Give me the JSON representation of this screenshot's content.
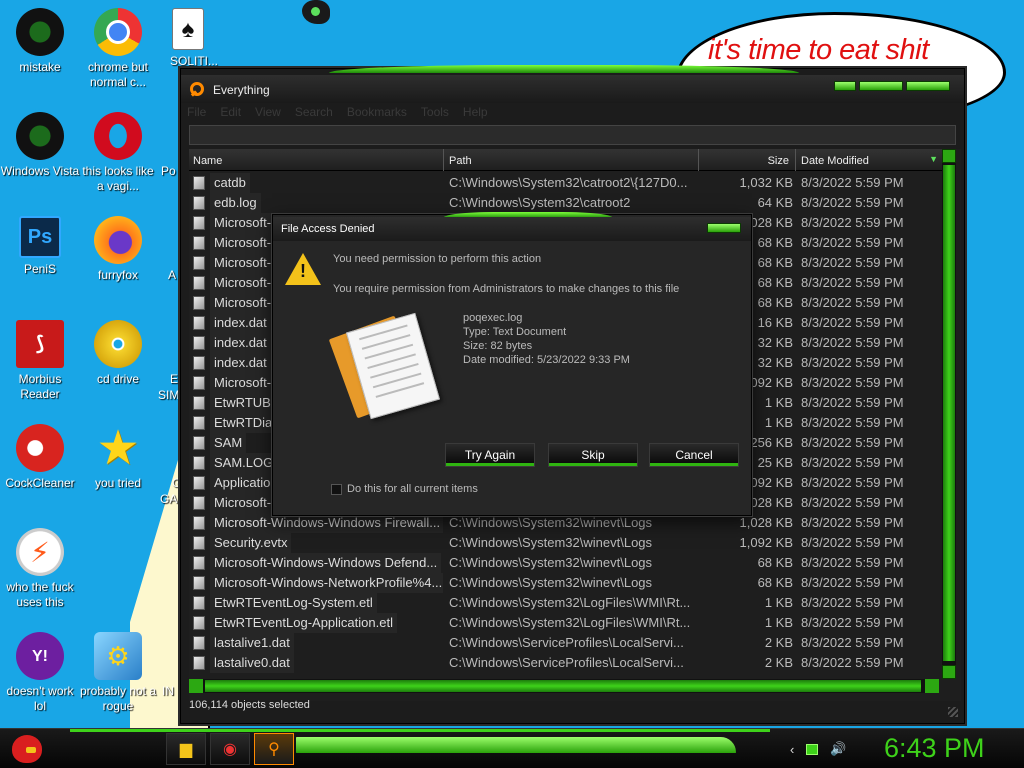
{
  "desktop": {
    "bubble_text": "it's time to eat shit",
    "icons": [
      {
        "id": "mistake",
        "label": "mistake",
        "icon": "razer-icon"
      },
      {
        "id": "chrome",
        "label": "chrome but normal c...",
        "icon": "chrome-icon"
      },
      {
        "id": "solitaire",
        "label": "SOLITI...",
        "icon": "cards-icon"
      },
      {
        "id": "windows-vista",
        "label": "Windows Vista",
        "icon": "razer-icon"
      },
      {
        "id": "opera",
        "label": "this looks like a vagi...",
        "icon": "opera-icon"
      },
      {
        "id": "penis",
        "label": "PeniS",
        "icon": "photoshop-icon"
      },
      {
        "id": "furryfox",
        "label": "furryfox",
        "icon": "firefox-icon"
      },
      {
        "id": "morbius",
        "label": "Morbius Reader",
        "icon": "pdf-icon"
      },
      {
        "id": "cd-drive",
        "label": "cd drive",
        "icon": "cd-icon"
      },
      {
        "id": "cockcleaner",
        "label": "CockCleaner",
        "icon": "ccleaner-icon"
      },
      {
        "id": "you-tried",
        "label": "you tried",
        "icon": "star-icon"
      },
      {
        "id": "flash",
        "label": "who the fuck uses this",
        "icon": "flash-icon"
      },
      {
        "id": "yahoo",
        "label": "doesn't work lol",
        "icon": "yahoo-icon"
      },
      {
        "id": "rogue",
        "label": "probably not a rogue",
        "icon": "gears-icon"
      }
    ],
    "peek_labels": [
      "Po",
      "A",
      "E",
      "SIM",
      "G",
      "GA",
      "IN"
    ]
  },
  "window": {
    "title": "Everything",
    "menu": [
      "File",
      "Edit",
      "View",
      "Search",
      "Bookmarks",
      "Tools",
      "Help"
    ],
    "columns": {
      "name": "Name",
      "path": "Path",
      "size": "Size",
      "date": "Date Modified"
    },
    "rows": [
      {
        "name": "catdb",
        "path": "C:\\Windows\\System32\\catroot2\\{127D0...",
        "size": "1,032 KB",
        "date": "8/3/2022 5:59 PM"
      },
      {
        "name": "edb.log",
        "path": "C:\\Windows\\System32\\catroot2",
        "size": "64 KB",
        "date": "8/3/2022 5:59 PM"
      },
      {
        "name": "Microsoft-W",
        "path": "",
        "size": "1,028 KB",
        "date": "8/3/2022 5:59 PM"
      },
      {
        "name": "Microsoft-W",
        "path": "",
        "size": "68 KB",
        "date": "8/3/2022 5:59 PM"
      },
      {
        "name": "Microsoft-W",
        "path": "",
        "size": "68 KB",
        "date": "8/3/2022 5:59 PM"
      },
      {
        "name": "Microsoft-W",
        "path": "",
        "size": "68 KB",
        "date": "8/3/2022 5:59 PM"
      },
      {
        "name": "Microsoft-W",
        "path": "",
        "size": "68 KB",
        "date": "8/3/2022 5:59 PM"
      },
      {
        "name": "index.dat",
        "path": "",
        "size": "16 KB",
        "date": "8/3/2022 5:59 PM"
      },
      {
        "name": "index.dat",
        "path": "",
        "size": "32 KB",
        "date": "8/3/2022 5:59 PM"
      },
      {
        "name": "index.dat",
        "path": "",
        "size": "32 KB",
        "date": "8/3/2022 5:59 PM"
      },
      {
        "name": "Microsoft-W",
        "path": "",
        "size": "1,092 KB",
        "date": "8/3/2022 5:59 PM"
      },
      {
        "name": "EtwRTUBP",
        "path": "",
        "size": "1 KB",
        "date": "8/3/2022 5:59 PM"
      },
      {
        "name": "EtwRTDia",
        "path": "",
        "size": "1 KB",
        "date": "8/3/2022 5:59 PM"
      },
      {
        "name": "SAM",
        "path": "",
        "size": "256 KB",
        "date": "8/3/2022 5:59 PM"
      },
      {
        "name": "SAM.LOG1",
        "path": "",
        "size": "25 KB",
        "date": "8/3/2022 5:59 PM"
      },
      {
        "name": "Application",
        "path": "",
        "size": "1,092 KB",
        "date": "8/3/2022 5:59 PM"
      },
      {
        "name": "Microsoft-W",
        "path": "",
        "size": "1,028 KB",
        "date": "8/3/2022 5:59 PM"
      },
      {
        "name": "Microsoft-Windows-Windows Firewall...",
        "path": "C:\\Windows\\System32\\winevt\\Logs",
        "size": "1,028 KB",
        "date": "8/3/2022 5:59 PM"
      },
      {
        "name": "Security.evtx",
        "path": "C:\\Windows\\System32\\winevt\\Logs",
        "size": "1,092 KB",
        "date": "8/3/2022 5:59 PM"
      },
      {
        "name": "Microsoft-Windows-Windows Defend...",
        "path": "C:\\Windows\\System32\\winevt\\Logs",
        "size": "68 KB",
        "date": "8/3/2022 5:59 PM"
      },
      {
        "name": "Microsoft-Windows-NetworkProfile%4...",
        "path": "C:\\Windows\\System32\\winevt\\Logs",
        "size": "68 KB",
        "date": "8/3/2022 5:59 PM"
      },
      {
        "name": "EtwRTEventLog-System.etl",
        "path": "C:\\Windows\\System32\\LogFiles\\WMI\\Rt...",
        "size": "1 KB",
        "date": "8/3/2022 5:59 PM"
      },
      {
        "name": "EtwRTEventLog-Application.etl",
        "path": "C:\\Windows\\System32\\LogFiles\\WMI\\Rt...",
        "size": "1 KB",
        "date": "8/3/2022 5:59 PM"
      },
      {
        "name": "lastalive1.dat",
        "path": "C:\\Windows\\ServiceProfiles\\LocalServi...",
        "size": "2 KB",
        "date": "8/3/2022 5:59 PM"
      },
      {
        "name": "lastalive0.dat",
        "path": "C:\\Windows\\ServiceProfiles\\LocalServi...",
        "size": "2 KB",
        "date": "8/3/2022 5:59 PM"
      }
    ],
    "status": "106,114 objects selected"
  },
  "dialog": {
    "title": "File Access Denied",
    "message1": "You need permission to perform this action",
    "message2": "You require permission from Administrators to make changes to this file",
    "file": {
      "name": "poqexec.log",
      "type": "Type: Text Document",
      "size": "Size: 82 bytes",
      "modified": "Date modified: 5/23/2022 9:33 PM"
    },
    "buttons": {
      "try_again": "Try Again",
      "skip": "Skip",
      "cancel": "Cancel"
    },
    "checkbox_label": "Do this for all current items"
  },
  "taskbar": {
    "items": [
      "explorer-icon",
      "chrome-icon",
      "everything-icon"
    ],
    "clock": "6:43 PM"
  },
  "colors": {
    "accent_green": "#3ed21a",
    "desktop_blue": "#19a6e6",
    "bubble_red": "#e01010"
  }
}
